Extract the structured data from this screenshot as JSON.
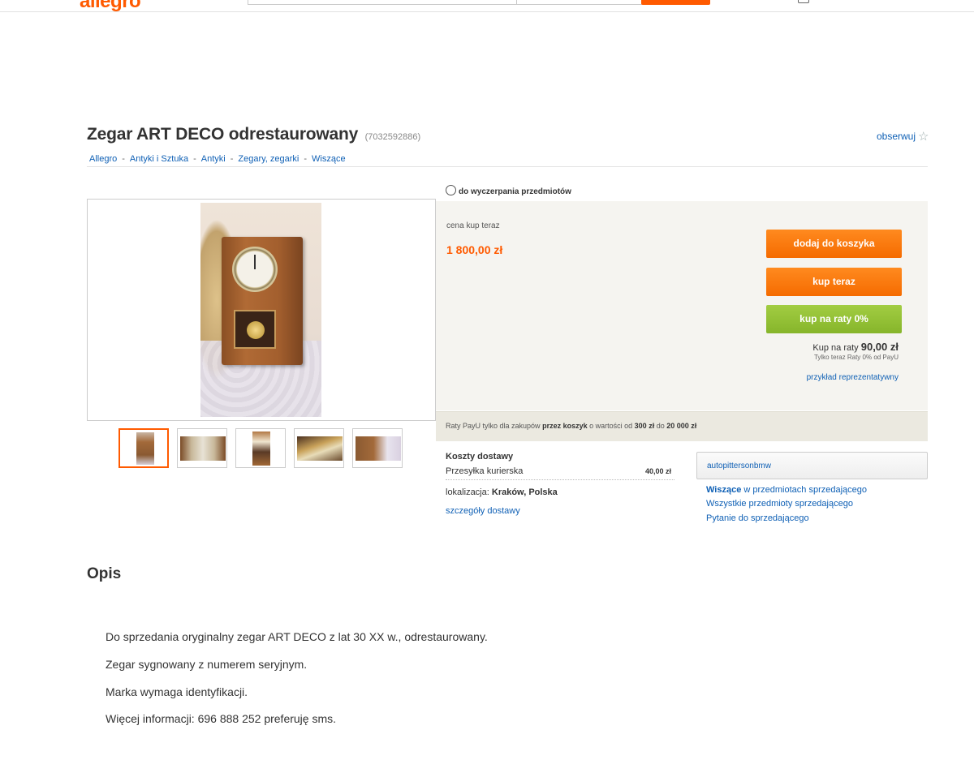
{
  "header": {
    "logo": "allegro",
    "brand_color": "#ff5a00"
  },
  "title": {
    "text": "Zegar ART DECO odrestaurowany",
    "item_id": "(7032592886)",
    "watch_label": "obserwuj"
  },
  "breadcrumb": [
    "Allegro",
    "Antyki i Sztuka",
    "Antyki",
    "Zegary, zegarki",
    "Wiszące"
  ],
  "offer": {
    "duration": "do wyczerpania przedmiotów",
    "price_label": "cena kup teraz",
    "price": "1 800,00 zł",
    "add_to_cart": "dodaj do koszyka",
    "buy_now": "kup teraz",
    "buy_installments": "kup na raty 0%",
    "installment_prefix": "Kup na raty",
    "installment_amount": "90,00 zł",
    "installment_note": "Tylko teraz Raty 0% od PayU",
    "example_link": "przykład reprezentatywny",
    "payu_prefix": "Raty PayU tylko dla zakupów",
    "payu_bold1": "przez koszyk",
    "payu_mid": "o wartości od",
    "payu_bold2": "300 zł",
    "payu_mid2": "do",
    "payu_bold3": "20 000 zł"
  },
  "shipping": {
    "title": "Koszty dostawy",
    "method": "Przesyłka kurierska",
    "cost": "40,00 zł",
    "location_label": "lokalizacja:",
    "location": "Kraków, Polska",
    "details_link": "szczegóły dostawy"
  },
  "seller": {
    "name": "autopittersonbmw",
    "link1_bold": "Wiszące",
    "link1_rest": "w przedmiotach sprzedającego",
    "link2": "Wszystkie przedmioty sprzedającego",
    "link3": "Pytanie do sprzedającego"
  },
  "description": {
    "heading": "Opis",
    "lines": [
      "Do sprzedania oryginalny zegar ART DECO z lat 30 XX w., odrestaurowany.",
      "Zegar sygnowany z numerem seryjnym.",
      "Marka wymaga identyfikacji.",
      "Więcej informacji: 696 888 252 preferuję sms."
    ]
  },
  "icons": {
    "watch": "star-icon",
    "duration": "stopwatch-icon",
    "cart": "cart-icon"
  }
}
